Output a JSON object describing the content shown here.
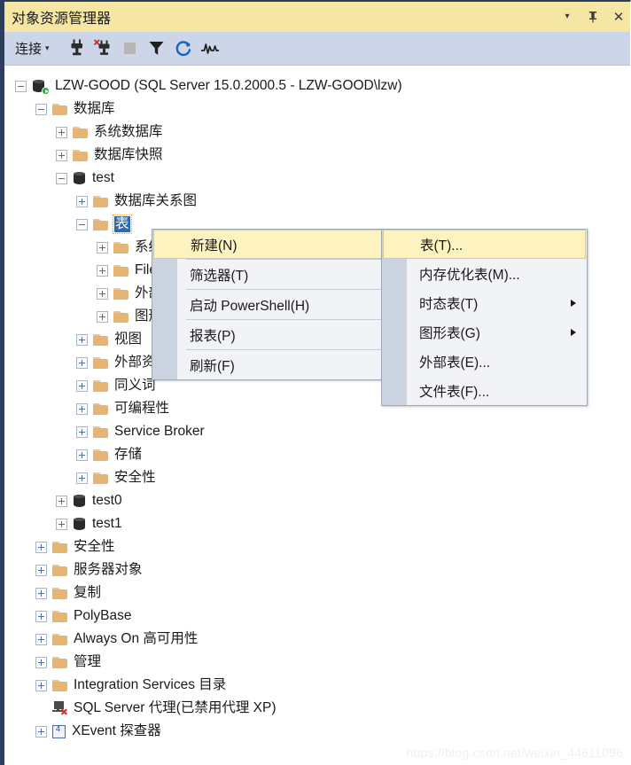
{
  "window": {
    "title": "对象资源管理器",
    "controls": [
      {
        "name": "dropdown-caret-icon",
        "glyph": "▾"
      },
      {
        "name": "pin-icon",
        "glyph": "⚲"
      },
      {
        "name": "close-icon",
        "glyph": "✕"
      }
    ]
  },
  "toolbar": {
    "connect_label": "连接",
    "connect_caret": "▾",
    "icons": [
      {
        "name": "connect-icon",
        "title": "连接"
      },
      {
        "name": "disconnect-icon",
        "title": "断开连接"
      },
      {
        "name": "stop-icon",
        "title": "停止"
      },
      {
        "name": "filter-icon",
        "title": "筛选器"
      },
      {
        "name": "refresh-icon",
        "title": "刷新"
      },
      {
        "name": "activity-monitor-icon",
        "title": "活动监视器"
      }
    ]
  },
  "tree": {
    "nodes": [
      {
        "label": "LZW-GOOD (SQL Server 15.0.2000.5 - LZW-GOOD\\lzw)",
        "indent": 0,
        "expander": "minus",
        "icon": "server",
        "name": "tree-node-server"
      },
      {
        "label": "数据库",
        "indent": 1,
        "expander": "minus",
        "icon": "folder",
        "name": "tree-node-databases"
      },
      {
        "label": "系统数据库",
        "indent": 2,
        "expander": "plus",
        "icon": "folder",
        "name": "tree-node-system-databases"
      },
      {
        "label": "数据库快照",
        "indent": 2,
        "expander": "plus",
        "icon": "folder",
        "name": "tree-node-database-snapshots"
      },
      {
        "label": "test",
        "indent": 2,
        "expander": "minus",
        "icon": "db",
        "name": "tree-node-db-test"
      },
      {
        "label": "数据库关系图",
        "indent": 3,
        "expander": "plus",
        "icon": "folder",
        "name": "tree-node-database-diagrams"
      },
      {
        "label": "表",
        "indent": 3,
        "expander": "minus",
        "icon": "folder",
        "name": "tree-node-tables",
        "selected": true
      },
      {
        "label": "系统表",
        "indent": 4,
        "expander": "plus",
        "icon": "folder",
        "name": "tree-node-system-tables"
      },
      {
        "label": "FileTables",
        "indent": 4,
        "expander": "plus",
        "icon": "folder",
        "name": "tree-node-filetables"
      },
      {
        "label": "外部表",
        "indent": 4,
        "expander": "plus",
        "icon": "folder",
        "name": "tree-node-external-tables"
      },
      {
        "label": "图形表",
        "indent": 4,
        "expander": "plus",
        "icon": "folder",
        "name": "tree-node-graph-tables"
      },
      {
        "label": "视图",
        "indent": 3,
        "expander": "plus",
        "icon": "folder",
        "name": "tree-node-views"
      },
      {
        "label": "外部资源",
        "indent": 3,
        "expander": "plus",
        "icon": "folder",
        "name": "tree-node-external-resources"
      },
      {
        "label": "同义词",
        "indent": 3,
        "expander": "plus",
        "icon": "folder",
        "name": "tree-node-synonyms"
      },
      {
        "label": "可编程性",
        "indent": 3,
        "expander": "plus",
        "icon": "folder",
        "name": "tree-node-programmability"
      },
      {
        "label": "Service Broker",
        "indent": 3,
        "expander": "plus",
        "icon": "folder",
        "name": "tree-node-service-broker"
      },
      {
        "label": "存储",
        "indent": 3,
        "expander": "plus",
        "icon": "folder",
        "name": "tree-node-storage"
      },
      {
        "label": "安全性",
        "indent": 3,
        "expander": "plus",
        "icon": "folder",
        "name": "tree-node-db-security"
      },
      {
        "label": "test0",
        "indent": 2,
        "expander": "plus",
        "icon": "db",
        "name": "tree-node-db-test0"
      },
      {
        "label": "test1",
        "indent": 2,
        "expander": "plus",
        "icon": "db",
        "name": "tree-node-db-test1"
      },
      {
        "label": "安全性",
        "indent": 1,
        "expander": "plus",
        "icon": "folder",
        "name": "tree-node-security"
      },
      {
        "label": "服务器对象",
        "indent": 1,
        "expander": "plus",
        "icon": "folder",
        "name": "tree-node-server-objects"
      },
      {
        "label": "复制",
        "indent": 1,
        "expander": "plus",
        "icon": "folder",
        "name": "tree-node-replication"
      },
      {
        "label": "PolyBase",
        "indent": 1,
        "expander": "plus",
        "icon": "folder",
        "name": "tree-node-polybase"
      },
      {
        "label": "Always On 高可用性",
        "indent": 1,
        "expander": "plus",
        "icon": "folder",
        "name": "tree-node-always-on"
      },
      {
        "label": "管理",
        "indent": 1,
        "expander": "plus",
        "icon": "folder",
        "name": "tree-node-management"
      },
      {
        "label": "Integration Services 目录",
        "indent": 1,
        "expander": "plus",
        "icon": "folder",
        "name": "tree-node-integration-services"
      },
      {
        "label": "SQL Server 代理(已禁用代理 XP)",
        "indent": 1,
        "expander": "none",
        "icon": "agent",
        "name": "tree-node-sql-server-agent"
      },
      {
        "label": "XEvent 探查器",
        "indent": 1,
        "expander": "plus",
        "icon": "xevent",
        "name": "tree-node-xevent-profiler"
      }
    ]
  },
  "context_menu": {
    "items": [
      {
        "label": "新建(N)",
        "submenu": true,
        "highlighted": true,
        "name": "menu-item-new",
        "sep_after": true
      },
      {
        "label": "筛选器(T)",
        "submenu": true,
        "highlighted": false,
        "name": "menu-item-filter",
        "sep_after": true
      },
      {
        "label": "启动 PowerShell(H)",
        "submenu": false,
        "highlighted": false,
        "name": "menu-item-start-powershell",
        "sep_after": true
      },
      {
        "label": "报表(P)",
        "submenu": true,
        "highlighted": false,
        "name": "menu-item-reports",
        "sep_after": true
      },
      {
        "label": "刷新(F)",
        "submenu": false,
        "highlighted": false,
        "name": "menu-item-refresh",
        "sep_after": false
      }
    ]
  },
  "submenu": {
    "items": [
      {
        "label": "表(T)...",
        "submenu": false,
        "highlighted": true,
        "name": "submenu-item-table"
      },
      {
        "label": "内存优化表(M)...",
        "submenu": false,
        "highlighted": false,
        "name": "submenu-item-memory-optimized-table"
      },
      {
        "label": "时态表(T)",
        "submenu": true,
        "highlighted": false,
        "name": "submenu-item-temporal-table"
      },
      {
        "label": "图形表(G)",
        "submenu": true,
        "highlighted": false,
        "name": "submenu-item-graph-table"
      },
      {
        "label": "外部表(E)...",
        "submenu": false,
        "highlighted": false,
        "name": "submenu-item-external-table"
      },
      {
        "label": "文件表(F)...",
        "submenu": false,
        "highlighted": false,
        "name": "submenu-item-file-table"
      }
    ]
  },
  "watermark": {
    "text": "https://blog.csdn.net/weixin_44611096"
  },
  "colors": {
    "title_bar": "#f5e6a3",
    "toolbar": "#ccd6e8",
    "menu_bg": "#f2f3f7",
    "menu_gutter": "#ccd3e0",
    "menu_highlight": "#fdf3c0",
    "selection": "#2a6bb5",
    "focus_outline": "#e8a33d",
    "window_border": "#2c3e5c",
    "folder": "#e6b574"
  }
}
